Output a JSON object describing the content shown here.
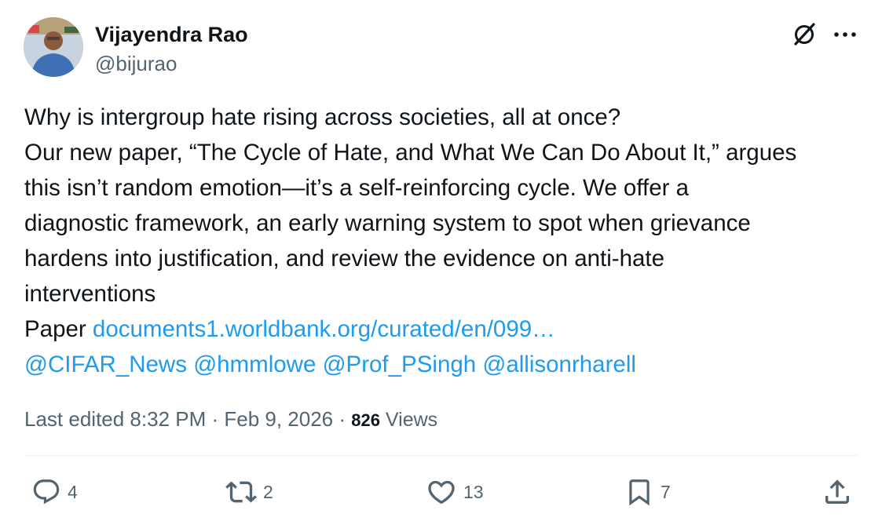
{
  "author": {
    "name": "Vijayendra Rao",
    "handle": "@bijurao"
  },
  "icons": {
    "grok": "grok-icon",
    "more": "more-icon",
    "reply": "reply-icon",
    "repost": "repost-icon",
    "like": "like-icon",
    "bookmark": "bookmark-icon",
    "share": "share-icon"
  },
  "tweet": {
    "lines": [
      "Why is intergroup hate rising across societies, all at once?",
      "Our new paper, “The Cycle of Hate, and What We Can Do About It,” argues",
      "this isn’t random emotion—it’s a self-reinforcing cycle. We offer a",
      "diagnostic framework, an early warning system to spot when grievance",
      "hardens into justification, and review the evidence on anti-hate",
      "interventions"
    ],
    "paper_prefix": "Paper ",
    "paper_link": "documents1.worldbank.org/curated/en/099…",
    "mentions": [
      "@CIFAR_News",
      "@hmmlowe",
      "@Prof_PSingh",
      "@allisonrharell"
    ]
  },
  "meta": {
    "edited_label": "Last edited 8:32 PM · Feb 9, 2026 · ",
    "views_count": "826",
    "views_label": " Views"
  },
  "actions": {
    "replies": "4",
    "reposts": "2",
    "likes": "13",
    "bookmarks": "7"
  },
  "colors": {
    "link": "#1d9bf0",
    "text": "#0f1419",
    "secondary": "#536471"
  }
}
